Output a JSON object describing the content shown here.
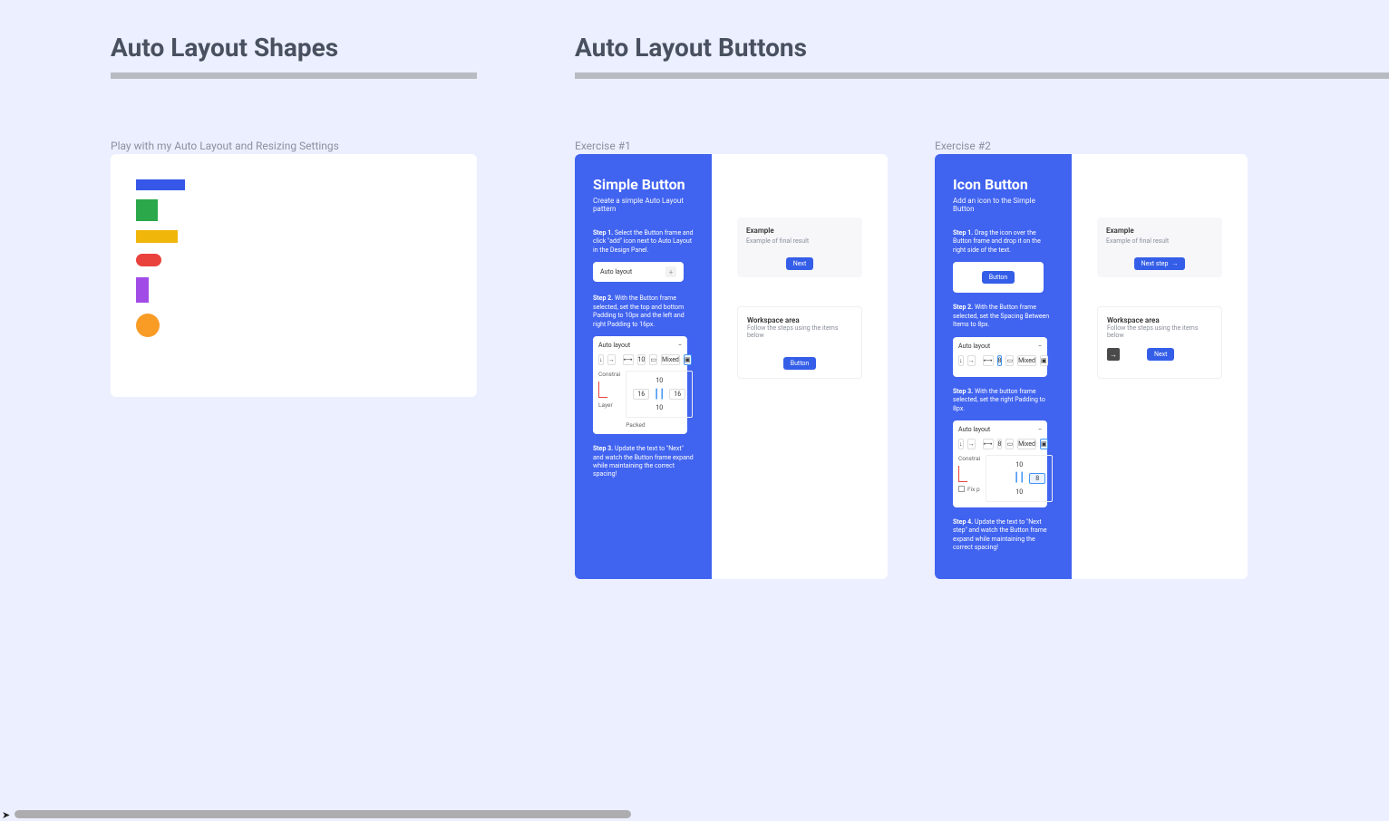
{
  "sections": {
    "shapes": {
      "title": "Auto Layout Shapes"
    },
    "buttons": {
      "title": "Auto Layout Buttons"
    }
  },
  "shapes_panel": {
    "subtitle": "Play with my Auto Layout and Resizing Settings"
  },
  "ex1": {
    "subtitle": "Exercise #1",
    "title": "Simple Button",
    "desc": "Create a simple Auto Layout pattern",
    "step1_label": "Step 1.",
    "step1_text": "Select the Button frame and click \"add\" icon next to Auto Layout in the Design Panel.",
    "auto_layout_label": "Auto layout",
    "step2_label": "Step 2.",
    "step2_text": "With the Button frame selected, set the top and bottom Padding to 10px and the left and right Padding to 16px.",
    "inspector": {
      "hdr": "Auto layout",
      "gap": "10",
      "mixed": "Mixed",
      "constraints": "Constrai",
      "pad_top": "10",
      "pad_left": "16",
      "pad_right": "16",
      "pad_bottom": "10",
      "layer": "Layer",
      "packed": "Packed"
    },
    "step3_label": "Step 3.",
    "step3_text": "Update the text to \"Next\" and watch the Button frame expand while maintaining the correct spacing!",
    "example_title": "Example",
    "example_sub": "Example of final result",
    "example_btn": "Next",
    "workspace_title": "Workspace area",
    "workspace_sub": "Follow the steps using the items below",
    "workspace_btn": "Button"
  },
  "ex2": {
    "subtitle": "Exercise #2",
    "title": "Icon Button",
    "desc": "Add an icon to the Simple Button",
    "step1_label": "Step 1.",
    "step1_text": "Drag the icon over the Button frame and drop it on the right side of the text.",
    "frame_btn": "Button",
    "step2_label": "Step 2.",
    "step2_text": "With the Button frame selected, set the Spacing Between Items to 8px.",
    "inspector1": {
      "hdr": "Auto layout",
      "gap": "8",
      "mixed": "Mixed"
    },
    "step3_label": "Step 3.",
    "step3_text": "With the button frame selected, set the right Padding to 8px.",
    "inspector2": {
      "hdr": "Auto layout",
      "gap": "8",
      "mixed": "Mixed",
      "constraints": "Constrai",
      "pad_top": "10",
      "pad_right": "8",
      "pad_bottom": "10",
      "fix": "Fix p"
    },
    "step4_label": "Step 4.",
    "step4_text": "Update the text to \"Next step\" and watch the Button frame expand while maintaining the correct spacing!",
    "example_title": "Example",
    "example_sub": "Example of final result",
    "example_btn": "Next step",
    "workspace_title": "Workspace area",
    "workspace_sub": "Follow the steps using the items below",
    "workspace_btn": "Next"
  },
  "colors": {
    "blue": "#3657e8",
    "green": "#2ba84a",
    "yellow": "#f1b60a",
    "red": "#e9423d",
    "purple": "#a24ce8",
    "orange": "#f89c26"
  }
}
